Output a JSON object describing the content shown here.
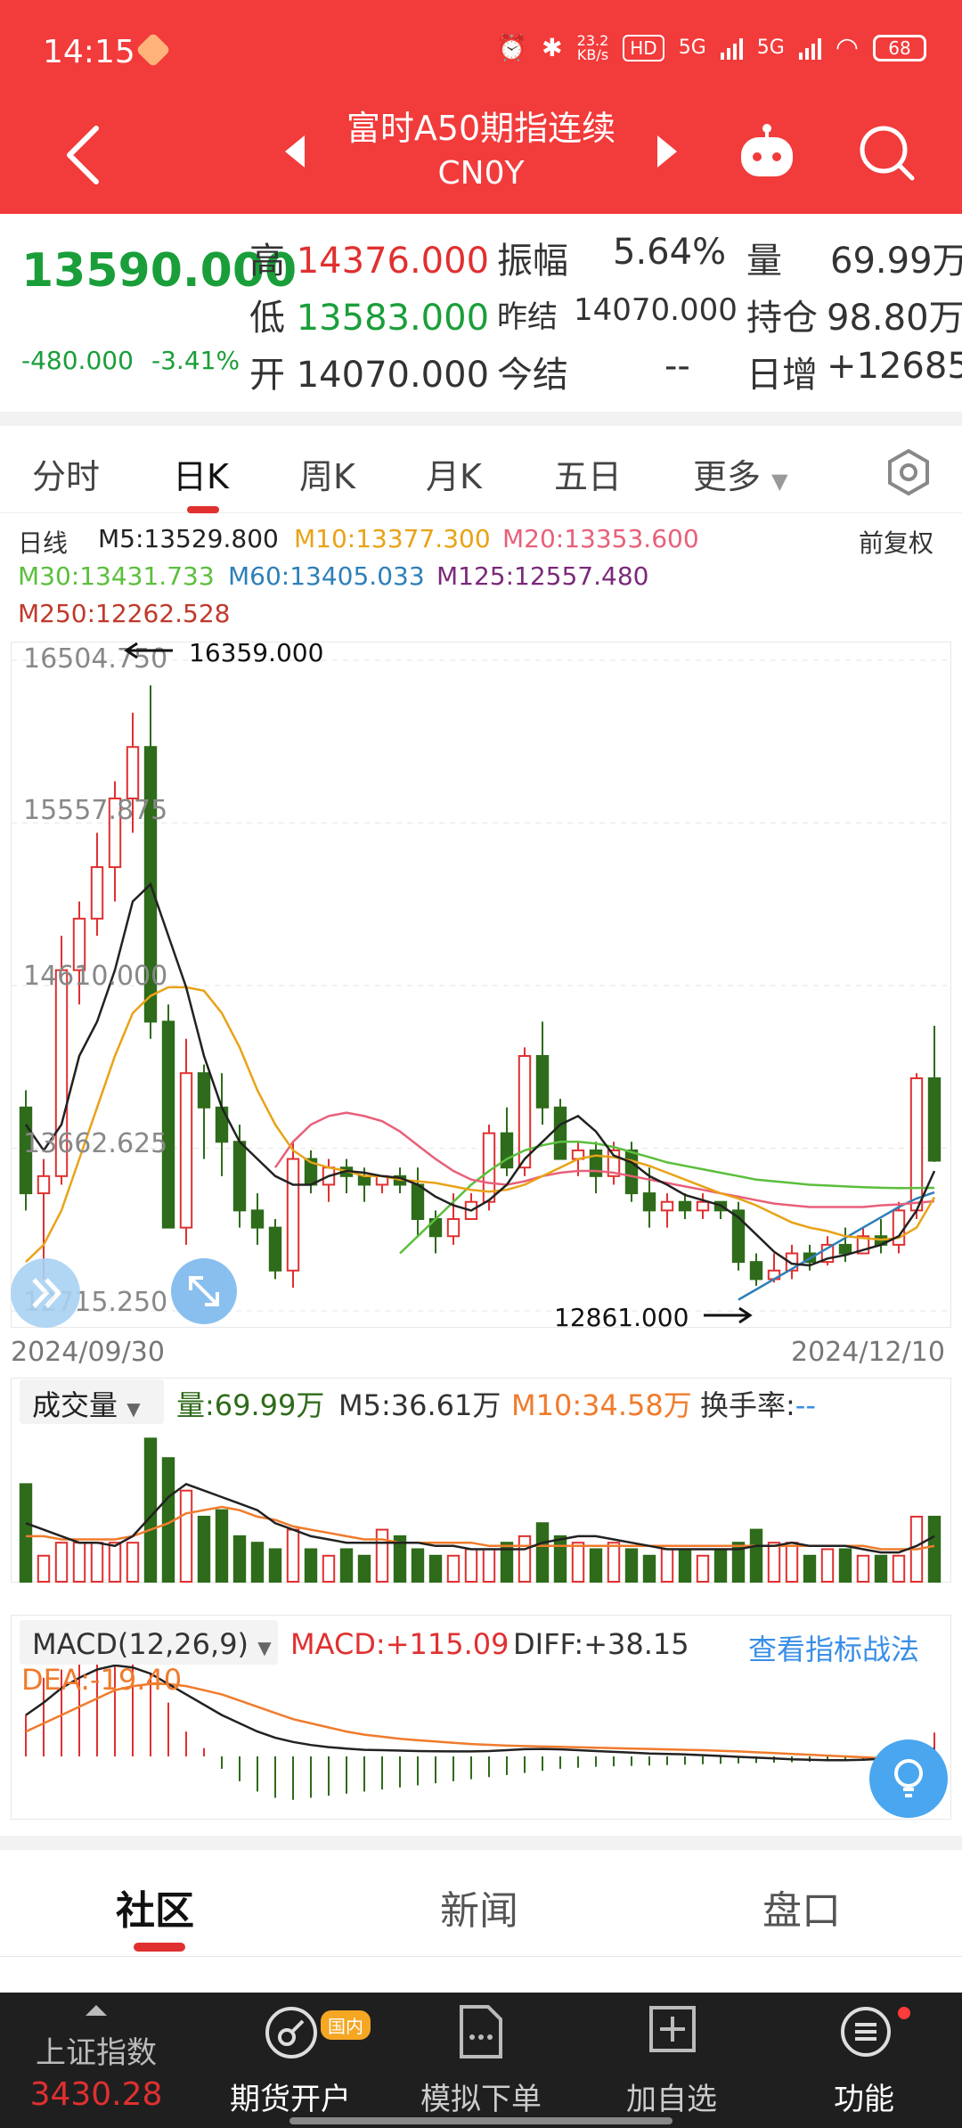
{
  "status_bar": {
    "time": "14:15",
    "net_speed_top": "23.2",
    "net_speed_bottom": "KB/s",
    "hd": "HD",
    "signal1": "5G",
    "signal2": "5G",
    "battery": "68"
  },
  "header": {
    "title": "富时A50期指连续",
    "code": "CN0Y"
  },
  "quote": {
    "price": "13590.000",
    "change": "-480.000",
    "change_pct": "-3.41%",
    "high_label": "高",
    "high_value": "14376.000",
    "low_label": "低",
    "low_value": "13583.000",
    "open_label": "开",
    "open_value": "14070.000",
    "amp_label": "振幅",
    "amp_value": "5.64%",
    "prev_settle_label": "昨结",
    "prev_settle_value": "14070.000",
    "today_settle_label": "今结",
    "today_settle_value": "--",
    "vol_label": "量",
    "vol_value": "69.99万",
    "oi_label": "持仓",
    "oi_value": "98.80万",
    "daily_inc_label": "日增",
    "daily_inc_value": "+12685"
  },
  "tabs": [
    "分时",
    "日K",
    "周K",
    "月K",
    "五日",
    "更多"
  ],
  "chart_header": {
    "kind": "日线",
    "adjust": "前复权",
    "m5": "M5:13529.800",
    "m10": "M10:13377.300",
    "m20": "M20:13353.600",
    "m30": "M30:13431.733",
    "m60": "M60:13405.033",
    "m125": "M125:12557.480",
    "m250": "M250:12262.528"
  },
  "colors": {
    "m5": "#222222",
    "m10": "#e8a317",
    "m20": "#e8607a",
    "m30": "#5bbf3c",
    "m60": "#2d7fb8",
    "m125": "#7a2a7a",
    "m250": "#c0392b",
    "up": "#e03030",
    "down": "#2e6b1a"
  },
  "chart_data": {
    "type": "candlestick",
    "y_ticks": [
      "16504.750",
      "15557.875",
      "14610.000",
      "13662.625",
      "12715.250"
    ],
    "ylim": [
      12715.25,
      16504.75
    ],
    "x_start": "2024/09/30",
    "x_end": "2024/12/10",
    "max_label": "16359.000",
    "min_label": "12861.000",
    "candles": [
      [
        13900,
        13400,
        14000,
        13300
      ],
      [
        13400,
        13500,
        13600,
        12900
      ],
      [
        13500,
        14700,
        14900,
        13450
      ],
      [
        14700,
        15000,
        15100,
        14500
      ],
      [
        15000,
        15300,
        15500,
        14900
      ],
      [
        15300,
        15700,
        15800,
        15100
      ],
      [
        15700,
        16000,
        16200,
        15500
      ],
      [
        16000,
        14400,
        16359,
        14300
      ],
      [
        14400,
        13200,
        14500,
        13200
      ],
      [
        13200,
        14100,
        14300,
        13100
      ],
      [
        14100,
        13900,
        14150,
        13600
      ],
      [
        13900,
        13700,
        14100,
        13500
      ],
      [
        13700,
        13300,
        13800,
        13200
      ],
      [
        13300,
        13200,
        13400,
        13100
      ],
      [
        13200,
        12950,
        13250,
        12900
      ],
      [
        12950,
        13600,
        13700,
        12850
      ],
      [
        13600,
        13450,
        13650,
        13400
      ],
      [
        13450,
        13550,
        13600,
        13350
      ],
      [
        13550,
        13500,
        13600,
        13400
      ],
      [
        13500,
        13450,
        13550,
        13350
      ],
      [
        13450,
        13500,
        13500,
        13400
      ],
      [
        13500,
        13450,
        13550,
        13400
      ],
      [
        13450,
        13250,
        13550,
        13150
      ],
      [
        13250,
        13150,
        13300,
        13050
      ],
      [
        13150,
        13250,
        13400,
        13100
      ],
      [
        13250,
        13350,
        13400,
        13250
      ],
      [
        13350,
        13750,
        13800,
        13300
      ],
      [
        13750,
        13550,
        13900,
        13500
      ],
      [
        13550,
        14200,
        14250,
        13500
      ],
      [
        14200,
        13900,
        14400,
        13800
      ],
      [
        13900,
        13600,
        13950,
        13600
      ],
      [
        13600,
        13650,
        13700,
        13500
      ],
      [
        13650,
        13500,
        13700,
        13400
      ],
      [
        13500,
        13650,
        13700,
        13450
      ],
      [
        13650,
        13400,
        13700,
        13350
      ],
      [
        13400,
        13300,
        13550,
        13200
      ],
      [
        13300,
        13350,
        13400,
        13200
      ],
      [
        13350,
        13300,
        13400,
        13250
      ],
      [
        13300,
        13350,
        13400,
        13250
      ],
      [
        13350,
        13300,
        13350,
        13250
      ],
      [
        13300,
        13000,
        13350,
        12950
      ],
      [
        13000,
        12900,
        13050,
        12861
      ],
      [
        12900,
        12950,
        13050,
        12880
      ],
      [
        12950,
        13050,
        13100,
        12900
      ],
      [
        13050,
        13000,
        13100,
        12950
      ],
      [
        13000,
        13100,
        13150,
        12980
      ],
      [
        13100,
        13050,
        13200,
        13000
      ],
      [
        13050,
        13150,
        13200,
        13050
      ],
      [
        13150,
        13100,
        13250,
        13050
      ],
      [
        13100,
        13300,
        13350,
        13050
      ],
      [
        13300,
        14070,
        14100,
        13250
      ],
      [
        14070,
        13590,
        14376,
        13583
      ]
    ],
    "ma5": [
      13800,
      13650,
      13800,
      14200,
      14400,
      14700,
      15100,
      15200,
      14900,
      14600,
      14200,
      13900,
      13700,
      13600,
      13500,
      13450,
      13450,
      13500,
      13530,
      13520,
      13500,
      13490,
      13450,
      13380,
      13330,
      13300,
      13360,
      13450,
      13600,
      13700,
      13800,
      13850,
      13760,
      13620,
      13580,
      13500,
      13450,
      13390,
      13360,
      13330,
      13260,
      13160,
      13060,
      12990,
      12980,
      13020,
      13040,
      13070,
      13100,
      13150,
      13300,
      13529.8
    ],
    "ma10": [
      13000,
      13100,
      13300,
      13600,
      13900,
      14200,
      14450,
      14550,
      14600,
      14600,
      14580,
      14450,
      14250,
      14000,
      13800,
      13650,
      13580,
      13550,
      13530,
      13500,
      13500,
      13480,
      13470,
      13460,
      13440,
      13420,
      13410,
      13420,
      13450,
      13500,
      13550,
      13600,
      13620,
      13610,
      13590,
      13560,
      13520,
      13480,
      13440,
      13400,
      13370,
      13330,
      13280,
      13230,
      13200,
      13180,
      13150,
      13140,
      13130,
      13140,
      13200,
      13377.3
    ],
    "ma20": [
      null,
      null,
      null,
      null,
      null,
      null,
      null,
      null,
      null,
      null,
      null,
      null,
      null,
      null,
      13550,
      13700,
      13800,
      13850,
      13870,
      13850,
      13820,
      13760,
      13680,
      13600,
      13530,
      13480,
      13460,
      13450,
      13470,
      13500,
      13520,
      13530,
      13530,
      13520,
      13500,
      13480,
      13460,
      13440,
      13420,
      13400,
      13380,
      13360,
      13340,
      13330,
      13320,
      13320,
      13320,
      13320,
      13330,
      13335,
      13345,
      13353.6
    ],
    "ma30": [
      null,
      null,
      null,
      null,
      null,
      null,
      null,
      null,
      null,
      null,
      null,
      null,
      null,
      null,
      null,
      null,
      null,
      null,
      null,
      null,
      null,
      13050,
      13150,
      13250,
      13350,
      13450,
      13530,
      13600,
      13650,
      13680,
      13700,
      13700,
      13690,
      13670,
      13640,
      13610,
      13580,
      13560,
      13540,
      13520,
      13500,
      13480,
      13470,
      13460,
      13450,
      13445,
      13440,
      13435,
      13432,
      13430,
      13431,
      13431.7
    ],
    "ma60": [
      null,
      null,
      null,
      null,
      null,
      null,
      null,
      null,
      null,
      null,
      null,
      null,
      null,
      null,
      null,
      null,
      null,
      null,
      null,
      null,
      null,
      null,
      null,
      null,
      null,
      null,
      null,
      null,
      null,
      null,
      null,
      null,
      null,
      null,
      null,
      null,
      null,
      null,
      null,
      null,
      12780,
      12840,
      12900,
      12960,
      13020,
      13080,
      13140,
      13200,
      13260,
      13320,
      13370,
      13405.0
    ],
    "volume": [
      30,
      8,
      12,
      12,
      12,
      12,
      12,
      44,
      38,
      28,
      20,
      22,
      14,
      12,
      10,
      16,
      10,
      8,
      10,
      8,
      16,
      14,
      10,
      8,
      8,
      10,
      10,
      12,
      14,
      18,
      14,
      12,
      10,
      12,
      10,
      8,
      10,
      10,
      8,
      10,
      12,
      16,
      12,
      12,
      8,
      10,
      10,
      8,
      8,
      8,
      20,
      20
    ],
    "vol_ma5": [
      18,
      16,
      14,
      12,
      12,
      11,
      14,
      20,
      26,
      30,
      28,
      26,
      24,
      22,
      18,
      16,
      14,
      13,
      12,
      12,
      12,
      12,
      12,
      11,
      11,
      10,
      10,
      10,
      10,
      12,
      13,
      14,
      14,
      13,
      12,
      11,
      10,
      10,
      10,
      10,
      10,
      11,
      11,
      12,
      11,
      11,
      11,
      10,
      9,
      9,
      11,
      14
    ],
    "vol_ma10": [
      14,
      14,
      13,
      13,
      13,
      13,
      14,
      16,
      18,
      21,
      22,
      23,
      22,
      20,
      19,
      17,
      16,
      15,
      14,
      13,
      13,
      12,
      12,
      12,
      12,
      12,
      11,
      11,
      11,
      11,
      11,
      11,
      11,
      11,
      11,
      11,
      11,
      11,
      11,
      11,
      11,
      11,
      11,
      11,
      11,
      11,
      11,
      11,
      10,
      10,
      10,
      11
    ],
    "macd_hist": [
      200,
      380,
      420,
      480,
      520,
      560,
      520,
      400,
      260,
      120,
      40,
      -60,
      -120,
      -170,
      -200,
      -210,
      -200,
      -190,
      -180,
      -170,
      -160,
      -150,
      -140,
      -130,
      -120,
      -110,
      -100,
      -90,
      -80,
      -70,
      -60,
      -55,
      -50,
      -48,
      -46,
      -44,
      -42,
      -40,
      -38,
      -36,
      -34,
      -32,
      -30,
      -28,
      -26,
      -24,
      -22,
      -20,
      -18,
      -16,
      -10,
      115.09
    ],
    "diff": [
      200,
      260,
      330,
      380,
      420,
      440,
      430,
      400,
      350,
      300,
      250,
      200,
      160,
      120,
      90,
      70,
      55,
      45,
      38,
      32,
      30,
      28,
      26,
      25,
      24,
      24,
      26,
      30,
      35,
      36,
      34,
      30,
      26,
      22,
      18,
      14,
      12,
      10,
      6,
      2,
      -2,
      -6,
      -10,
      -14,
      -16,
      -18,
      -18,
      -16,
      -12,
      -6,
      10,
      38.15
    ],
    "dea": [
      120,
      160,
      200,
      240,
      280,
      320,
      340,
      350,
      350,
      340,
      320,
      300,
      270,
      240,
      210,
      180,
      160,
      140,
      120,
      105,
      95,
      85,
      78,
      72,
      66,
      60,
      56,
      52,
      50,
      48,
      46,
      44,
      42,
      40,
      38,
      36,
      34,
      32,
      30,
      27,
      24,
      20,
      16,
      12,
      8,
      4,
      0,
      -4,
      -8,
      -12,
      -16,
      -19.4
    ]
  },
  "volume_header": {
    "dropdown": "成交量",
    "vol": "量:69.99万",
    "m5": "M5:36.61万",
    "m10": "M10:34.58万",
    "turnover": "换手率:",
    "turnover_value": "--"
  },
  "macd_header": {
    "dropdown": "MACD(12,26,9)",
    "macd": "MACD:+115.09",
    "diff": "DIFF:+38.15",
    "dea": "DEA:-19.40",
    "link": "查看指标战法"
  },
  "bottom_tabs": [
    "社区",
    "新闻",
    "盘口"
  ],
  "bottom_bar": {
    "index_name": "上证指数",
    "index_value": "3430.28",
    "open_account": "期货开户",
    "open_badge": "国内",
    "sim_order": "模拟下单",
    "add_watch": "加自选",
    "functions": "功能"
  }
}
